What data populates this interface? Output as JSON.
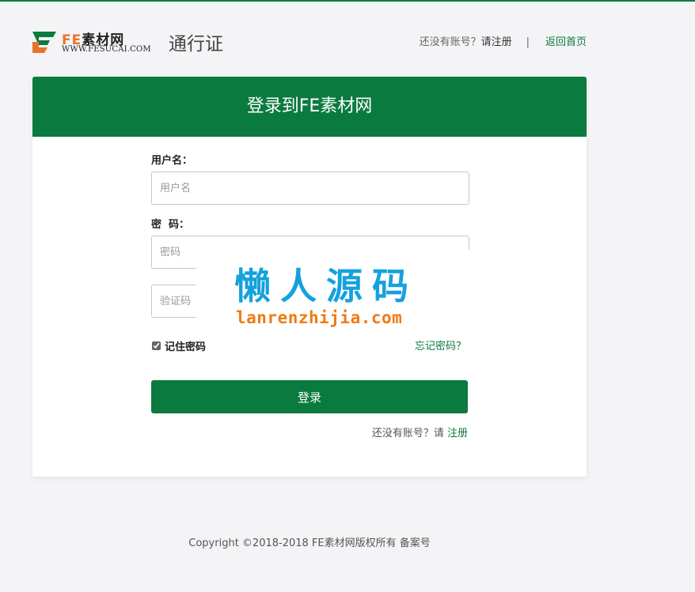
{
  "logo": {
    "brand_fe": "FE",
    "brand_cn": "素材网",
    "url": "WWW.FESUCAI.COM"
  },
  "header": {
    "title": "通行证",
    "no_account_text": "还没有账号？",
    "register_link": "请注册",
    "separator": "|",
    "home_link": "返回首页"
  },
  "card": {
    "title": "登录到FE素材网"
  },
  "form": {
    "username_label": "用户名：",
    "username_placeholder": "用户名",
    "password_label": "密  码：",
    "password_placeholder": "密码",
    "captcha_placeholder": "验证码",
    "remember_label": "记住密码",
    "remember_checked": true,
    "forgot_link": "忘记密码？",
    "login_button": "登录",
    "bottom_no_account": "还没有账号？请",
    "bottom_register_link": "注册"
  },
  "watermark": {
    "cn": "懒人源码",
    "en": "lanrenzhijia.com"
  },
  "footer": {
    "text": "Copyright ©2018-2018 FE素材网版权所有 备案号"
  },
  "colors": {
    "brand_green": "#0b7a3e",
    "brand_orange": "#e8742a",
    "page_bg": "#f4f3f6",
    "watermark_blue": "#15a1dd",
    "watermark_orange": "#f07a14"
  }
}
